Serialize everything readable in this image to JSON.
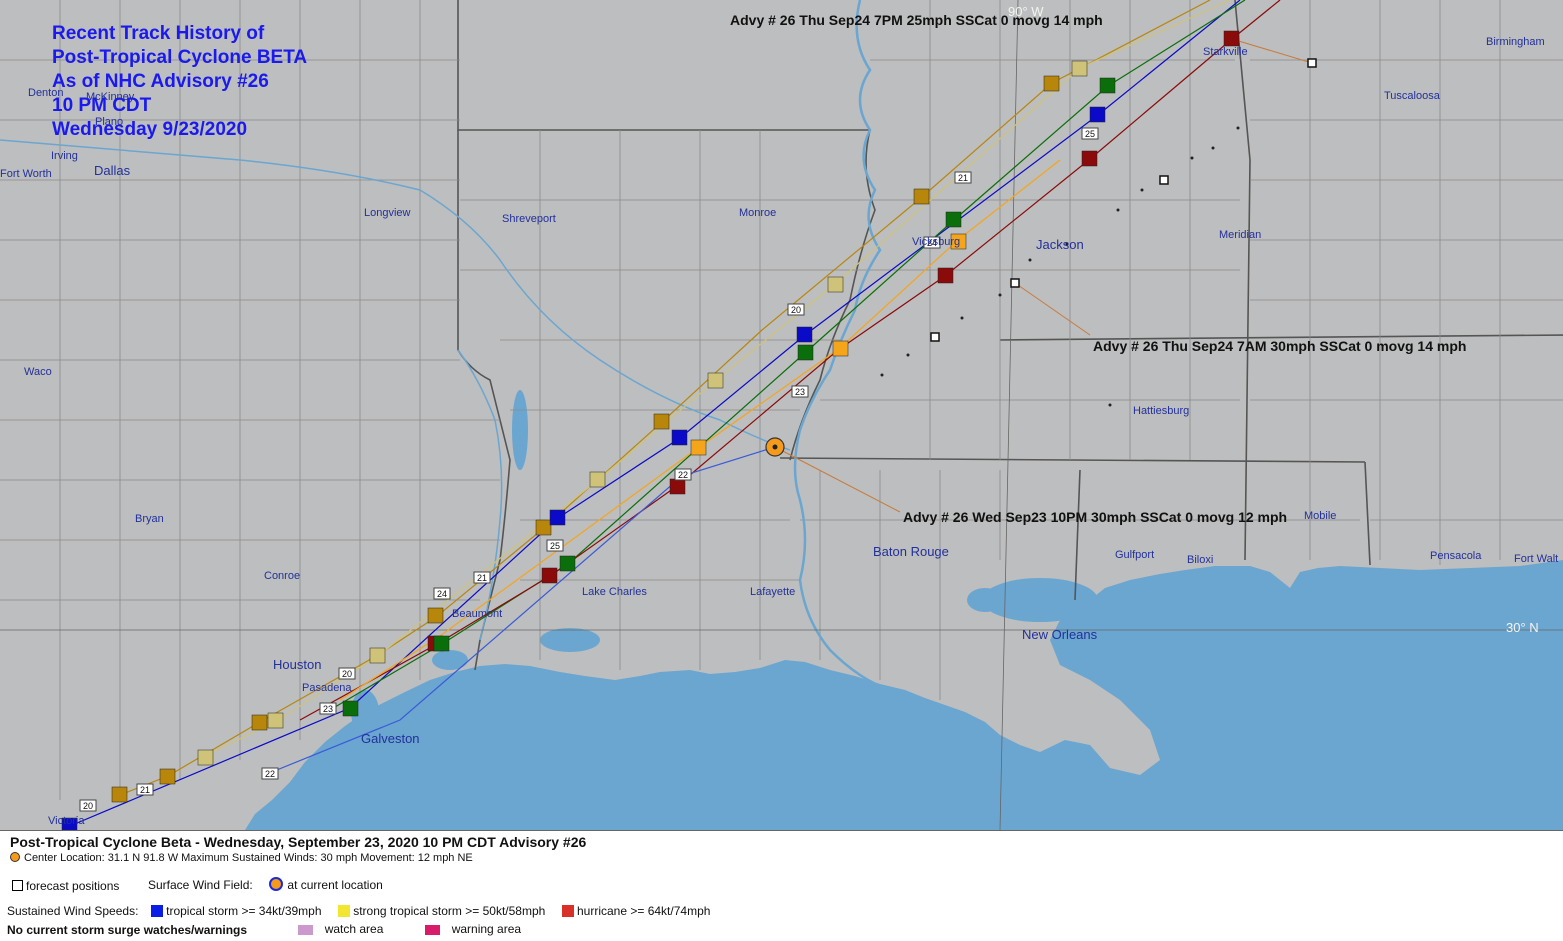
{
  "title_lines": [
    "Recent Track History of",
    "Post-Tropical Cyclone BETA",
    "As of NHC Advisory #26",
    "10 PM CDT",
    "Wednesday 9/23/2020"
  ],
  "advisory_labels": {
    "advy_7pm": "Advy # 26 Thu Sep24 7PM  25mph SSCat 0 movg 14 mph",
    "advy_7am": "Advy # 26 Thu Sep24 7AM  30mph SSCat 0 movg 14 mph",
    "advy_10pm": "Advy # 26 Wed Sep23 10PM  30mph SSCat 0 movg 12 mph"
  },
  "grid_labels": {
    "lon": "90° W",
    "lat": "30° N"
  },
  "cities": {
    "denton": "Denton",
    "mckinney": "McKinney",
    "plano": "Plano",
    "irving": "Irving",
    "fort_worth": "Fort Worth",
    "dallas": "Dallas",
    "longview": "Longview",
    "shreveport": "Shreveport",
    "monroe": "Monroe",
    "vicksburg": "Vicksburg",
    "jackson": "Jackson",
    "meridian": "Meridian",
    "starkville": "Starkville",
    "tuscaloosa": "Tuscaloosa",
    "birmingham": "Birmingham",
    "waco": "Waco",
    "bryan": "Bryan",
    "conroe": "Conroe",
    "beaumont": "Beaumont",
    "lake_charles": "Lake Charles",
    "lafayette": "Lafayette",
    "baton_rouge": "Baton Rouge",
    "hattiesburg": "Hattiesburg",
    "gulfport": "Gulfport",
    "biloxi": "Biloxi",
    "mobile": "Mobile",
    "pensacola": "Pensacola",
    "fort_walton": "Fort Walt",
    "new_orleans": "New Orleans",
    "houston": "Houston",
    "pasadena": "Pasadena",
    "galveston": "Galveston",
    "victoria": "Victoria"
  },
  "track": {
    "day_markers": [
      "20",
      "21",
      "22",
      "23",
      "24",
      "25"
    ],
    "current_center": {
      "lat": 31.1,
      "lon": -91.8
    },
    "category_colors": {
      "tropical_storm": "#0a0ac8",
      "strong_tropical_storm": "#e6e230",
      "hurricane": "#d42a1a",
      "track_green": "#0a6e0a",
      "track_gold": "#b8860b",
      "track_khaki": "#cfc37a",
      "track_orange": "#f5a51a",
      "track_darkred": "#8b0a0a"
    }
  },
  "legend": {
    "headline": "Post-Tropical Cyclone Beta  -  Wednesday, September 23, 2020  10 PM CDT   Advisory #26",
    "center_line": "Center Location: 31.1 N  91.8 W   Maximum Sustained Winds: 30 mph  Movement: 12 mph NE",
    "forecast_positions": "forecast positions",
    "surface_wind_field": "Surface Wind Field:",
    "at_current_location": "at current location",
    "sustained_wind_speeds": "Sustained Wind Speeds:",
    "ts_label": "tropical storm >= 34kt/39mph",
    "sts_label": "strong tropical storm >= 50kt/58mph",
    "hu_label": "hurricane >= 64kt/74mph",
    "surge_note": "No current storm surge watches/warnings",
    "watch_area": "watch area",
    "warning_area": "warning area",
    "colors": {
      "ts": "#0a1ee6",
      "sts": "#f2e631",
      "hu": "#d9312a",
      "watch": "#cc99cc",
      "warning": "#d81b6a"
    }
  }
}
